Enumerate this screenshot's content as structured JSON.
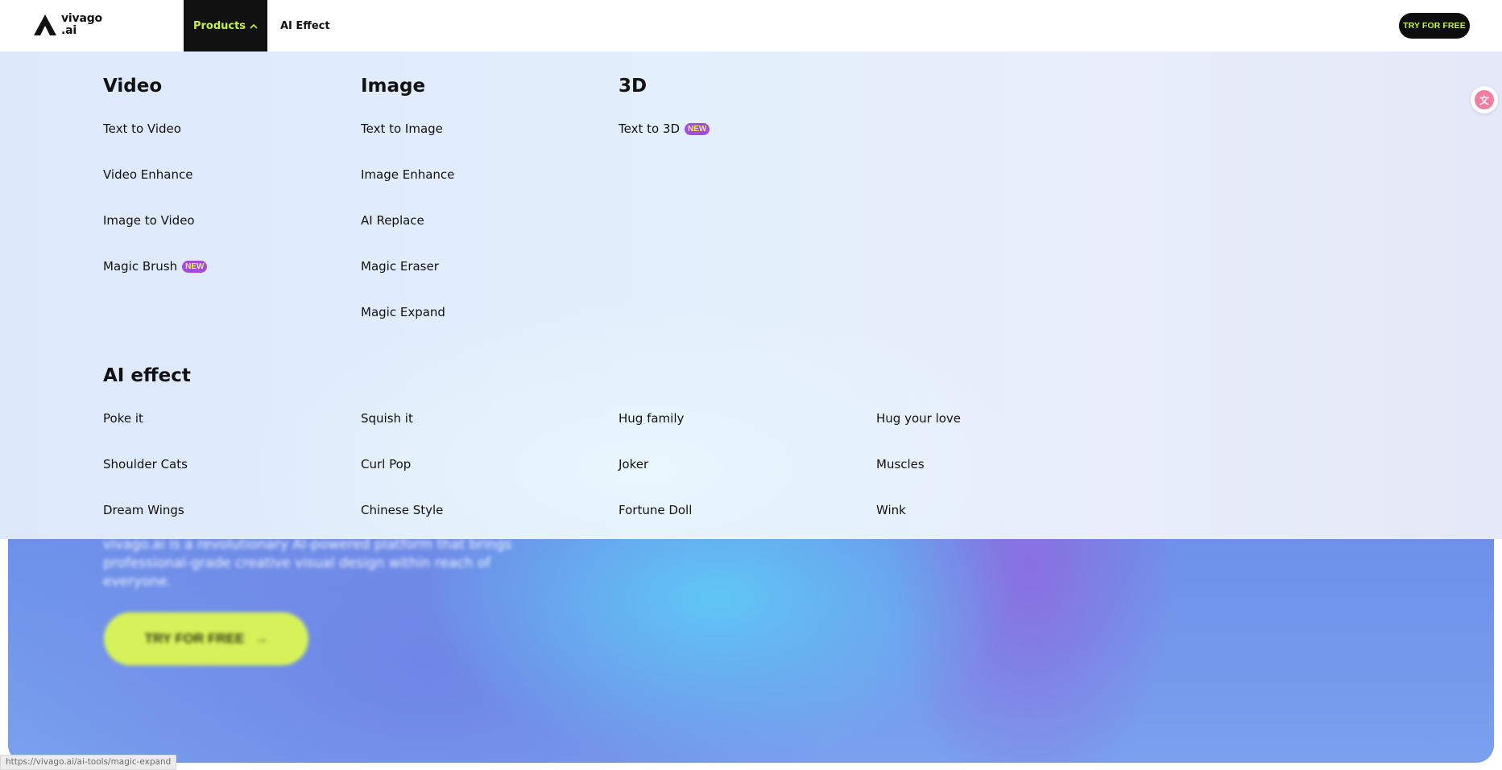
{
  "header": {
    "logo_line1": "vivago",
    "logo_line2": ".ai",
    "nav_products": "Products",
    "nav_ai_effect": "AI Effect",
    "try_button": "TRY FOR FREE"
  },
  "menu": {
    "video": {
      "title": "Video",
      "items": [
        "Text to Video",
        "Video Enhance",
        "Image to Video",
        "Magic Brush"
      ]
    },
    "image": {
      "title": "Image",
      "items": [
        "Text to Image",
        "Image Enhance",
        "AI Replace",
        "Magic Eraser",
        "Magic Expand"
      ]
    },
    "three_d": {
      "title": "3D",
      "items": [
        "Text to 3D"
      ]
    },
    "badge_new": "NEW",
    "ai_effect": {
      "title": "AI effect",
      "items": [
        "Poke it",
        "Squish it",
        "Hug family",
        "Hug your love",
        "Shoulder Cats",
        "Curl Pop",
        "Joker",
        "Muscles",
        "Dream Wings",
        "Chinese Style",
        "Fortune Doll",
        "Wink"
      ]
    }
  },
  "hero": {
    "description": "vivago.ai is a revolutionary AI-powered platform that brings professional-grade creative visual design within reach of everyone.",
    "cta": "TRY FOR FREE"
  },
  "status_url": "https://vivago.ai/ai-tools/magic-expand",
  "colors": {
    "accent_lime": "#c6f046",
    "badge_purple": "#a34be0",
    "header_dark": "#111111"
  },
  "icons": {
    "logo": "vivago-logo-mark",
    "products_chevron": "chevron-up-icon",
    "translate": "translate-icon",
    "hero_arrow": "arrow-right-icon"
  }
}
